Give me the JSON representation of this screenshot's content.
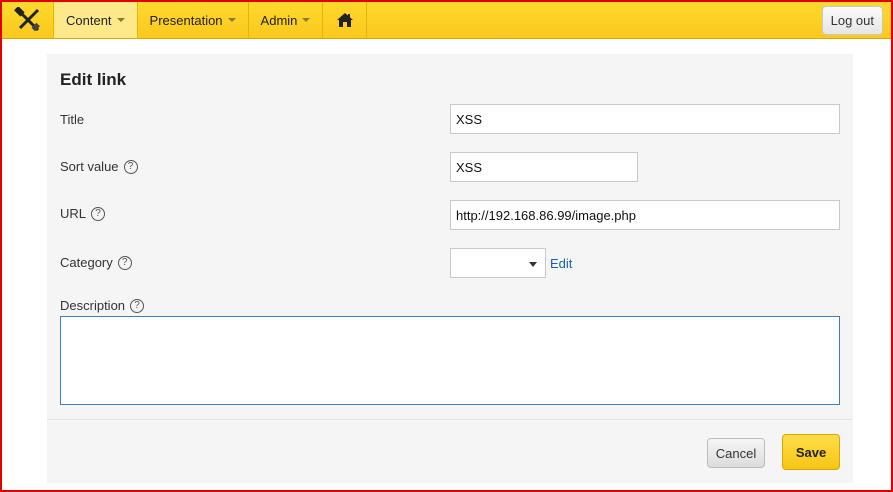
{
  "nav": {
    "brand_icon": "tools-icon",
    "items": [
      {
        "label": "Content",
        "active": true
      },
      {
        "label": "Presentation",
        "active": false
      },
      {
        "label": "Admin",
        "active": false
      }
    ],
    "home_icon": "home-icon",
    "logout_label": "Log out"
  },
  "form": {
    "title": "Edit link",
    "help_glyph": "?",
    "fields": {
      "title": {
        "label": "Title",
        "value": "XSS"
      },
      "sort": {
        "label": "Sort value",
        "value": "XSS"
      },
      "url": {
        "label": "URL",
        "value": "http://192.168.86.99/image.php"
      },
      "category": {
        "label": "Category",
        "value": "",
        "edit_label": "Edit"
      },
      "description": {
        "label": "Description",
        "value": ""
      }
    }
  },
  "footer": {
    "cancel_label": "Cancel",
    "save_label": "Save"
  },
  "colors": {
    "navbar": "#fbc81e",
    "accent_link": "#1a5fb4",
    "frame": "#e00000"
  }
}
